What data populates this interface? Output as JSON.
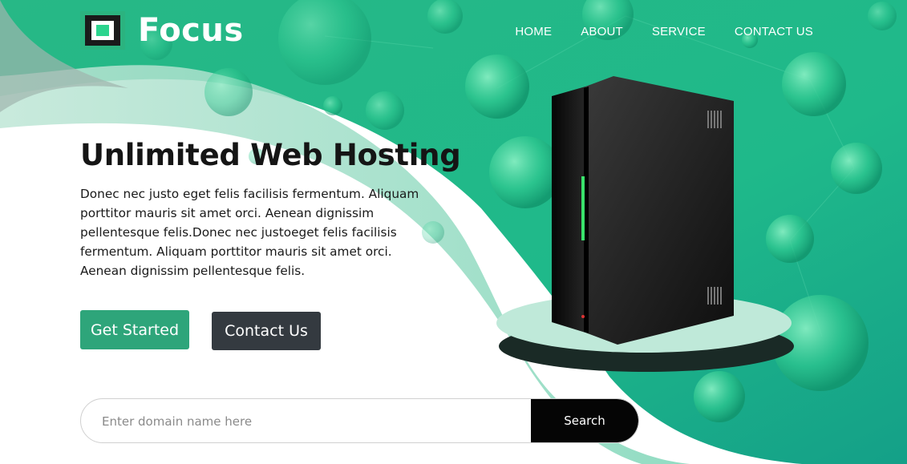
{
  "brand": {
    "name": "Focus",
    "logo_icon": "square-logo-icon"
  },
  "nav": {
    "items": [
      "HOME",
      "ABOUT",
      "SERVICE",
      "CONTACT US"
    ]
  },
  "hero": {
    "title": "Unlimited Web Hosting",
    "description": "Donec nec justo eget felis facilisis fermentum. Aliquam porttitor mauris sit amet orci. Aenean dignissim pellentesque felis.Donec nec justoeget felis facilisis fermentum. Aliquam porttitor mauris sit amet orci. Aenean dignissim pellentesque felis.",
    "get_started_label": "Get Started",
    "contact_label": "Contact Us"
  },
  "search": {
    "placeholder": "Enter domain name here",
    "button_label": "Search"
  },
  "colors": {
    "primary_green": "#2ea57a",
    "bright_green": "#21c08b",
    "dark_button": "#343a40",
    "search_button": "#050505"
  }
}
